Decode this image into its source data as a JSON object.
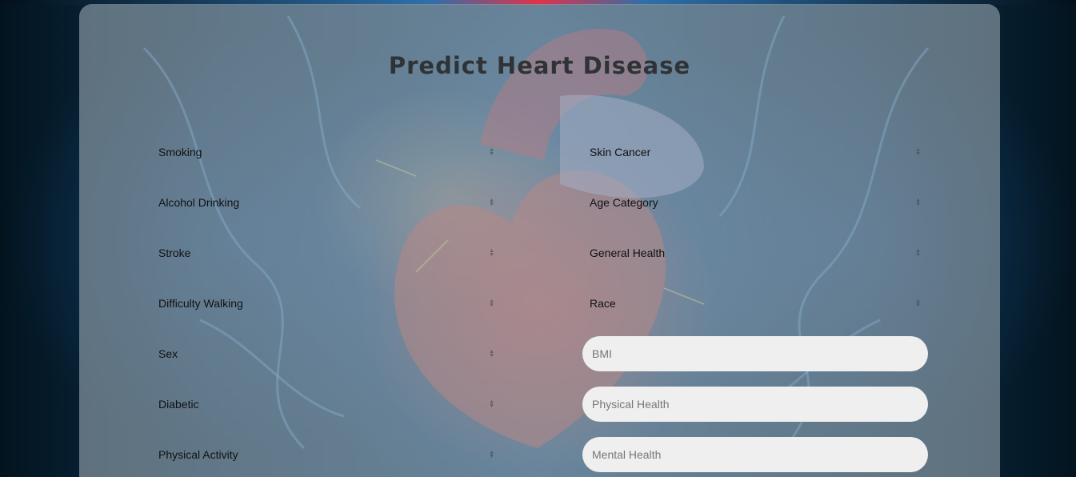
{
  "page": {
    "title": "Predict Heart Disease"
  },
  "left_fields": [
    {
      "label": "Smoking"
    },
    {
      "label": "Alcohol Drinking"
    },
    {
      "label": "Stroke"
    },
    {
      "label": "Difficulty Walking"
    },
    {
      "label": "Sex"
    },
    {
      "label": "Diabetic"
    },
    {
      "label": "Physical Activity"
    }
  ],
  "right_selects": [
    {
      "label": "Skin Cancer"
    },
    {
      "label": "Age Category"
    },
    {
      "label": "General Health"
    },
    {
      "label": "Race"
    }
  ],
  "right_inputs": [
    {
      "placeholder": "BMI"
    },
    {
      "placeholder": "Physical Health"
    },
    {
      "placeholder": "Mental Health"
    }
  ]
}
